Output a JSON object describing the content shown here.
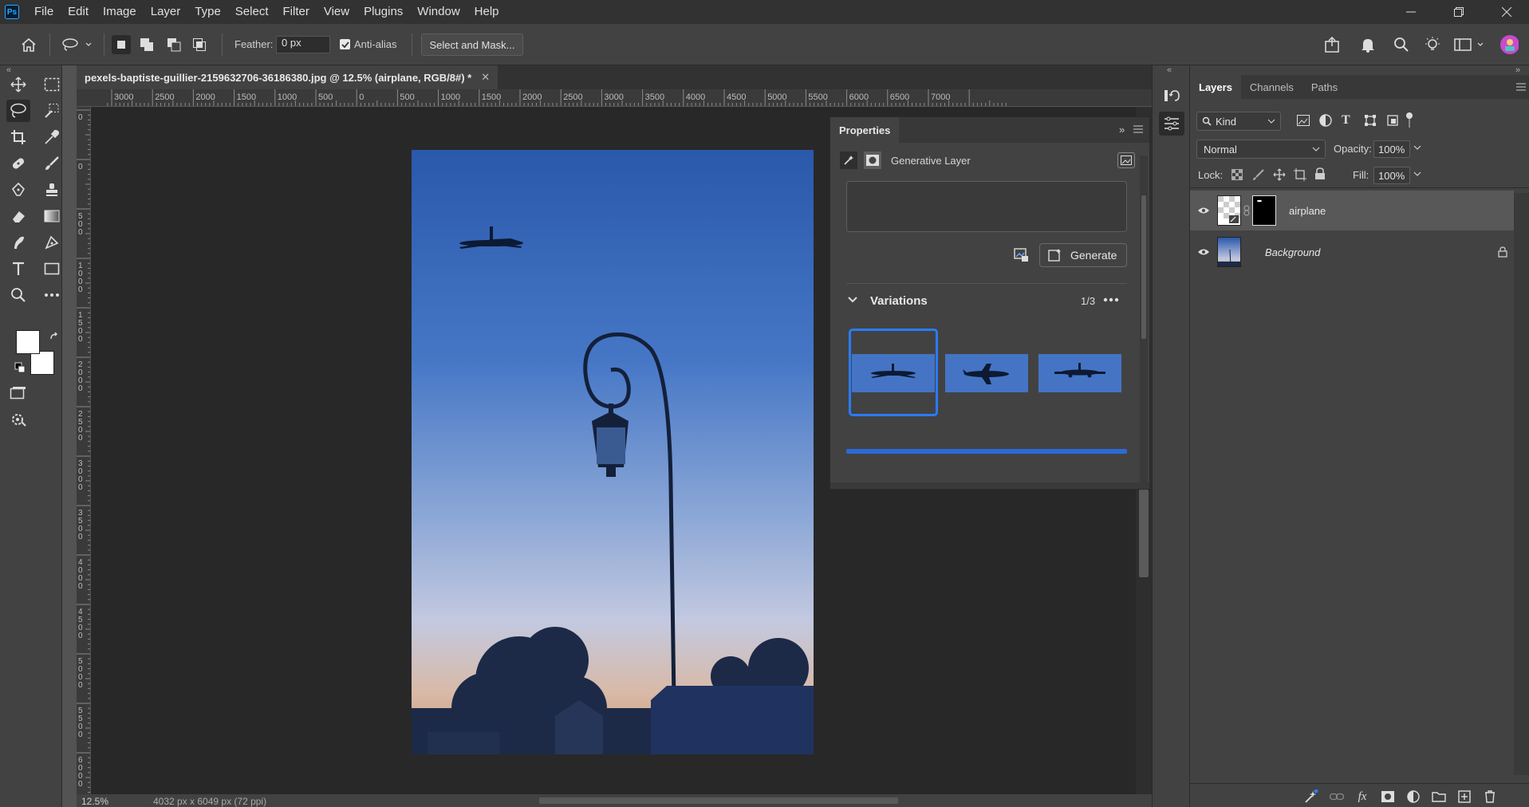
{
  "app": {
    "logo_text": "Ps"
  },
  "menu": [
    "File",
    "Edit",
    "Image",
    "Layer",
    "Type",
    "Select",
    "Filter",
    "View",
    "Plugins",
    "Window",
    "Help"
  ],
  "options": {
    "feather_label": "Feather:",
    "feather_value": "0 px",
    "antialias_label": "Anti-alias",
    "antialias_checked": true,
    "select_mask_label": "Select and Mask..."
  },
  "document": {
    "tab_title": "pexels-baptiste-guillier-2159632706-36186380.jpg @ 12.5% (airplane, RGB/8#) *",
    "ruler_labels": [
      "3000",
      "2500",
      "2000",
      "1500",
      "1000",
      "500",
      "0",
      "500",
      "1000",
      "1500",
      "2000",
      "2500",
      "3000",
      "3500",
      "4000",
      "4500",
      "5000",
      "5500",
      "6000",
      "6500",
      "7000"
    ],
    "ruler_v_labels": [
      "0",
      "0",
      "500",
      "1000",
      "1500",
      "2000",
      "2500",
      "3000",
      "3500",
      "4000",
      "4500",
      "5000",
      "5500",
      "6000"
    ],
    "zoom": "12.5%",
    "dimensions": "4032 px x 6049 px (72 ppi)"
  },
  "properties": {
    "title": "Properties",
    "layer_type": "Generative Layer",
    "generate_label": "Generate",
    "variations_label": "Variations",
    "variations_count": "1/3",
    "selected_variation": 1
  },
  "layers_panel": {
    "tabs": [
      "Layers",
      "Channels",
      "Paths"
    ],
    "active_tab": "Layers",
    "filter_kind": "Kind",
    "blend_mode": "Normal",
    "opacity_label": "Opacity:",
    "opacity_value": "100%",
    "lock_label": "Lock:",
    "fill_label": "Fill:",
    "fill_value": "100%",
    "layers": [
      {
        "name": "airplane",
        "visible": true,
        "selected": true,
        "locked": false
      },
      {
        "name": "Background",
        "visible": true,
        "selected": false,
        "locked": true
      }
    ]
  },
  "colors": {
    "accent": "#2a7bff",
    "sky_top": "#2d5fb3",
    "sky_bottom": "#e9b98c"
  }
}
